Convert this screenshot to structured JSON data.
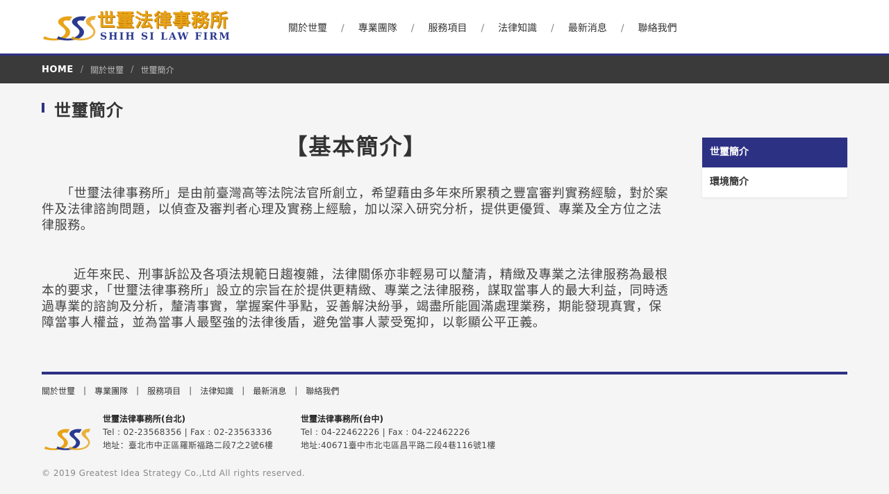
{
  "header": {
    "logo_name_zh": "世璽法律事務所",
    "logo_name_en": "SHIH SI LAW FIRM",
    "nav": [
      {
        "label": "關於世璽"
      },
      {
        "label": "專業團隊"
      },
      {
        "label": "服務項目"
      },
      {
        "label": "法律知識"
      },
      {
        "label": "最新消息"
      },
      {
        "label": "聯絡我們"
      }
    ],
    "nav_separator": "/"
  },
  "breadcrumb": {
    "home": "HOME",
    "separator": "/",
    "items": [
      "關於世璽",
      "世璽簡介"
    ]
  },
  "page": {
    "title": "世璽簡介",
    "section_title": "【基本簡介】",
    "paragraphs": [
      "「世璽法律事務所」是由前臺灣高等法院法官所創立，希望藉由多年來所累積之豐富審判實務經驗，對於案件及法律諮詢問題，以偵查及審判者心理及實務上經驗，加以深入研究分析，提供更優質、專業及全方位之法律服務。",
      "近年來民、刑事訴訟及各項法規範日趨複雜，法律關係亦非輕易可以釐清，精緻及專業之法律服務為最根本的要求，「世璽法律事務所」設立的宗旨在於提供更精緻、專業之法律服務，謀取當事人的最大利益，同時透過專業的諮詢及分析，釐清事實，掌握案件爭點，妥善解決紛爭，竭盡所能圓滿處理業務，期能發現真實，保障當事人權益，並為當事人最堅強的法律後盾，避免當事人蒙受冤抑，以彰顯公平正義。"
    ]
  },
  "sidebar": {
    "items": [
      {
        "label": "世璽簡介",
        "active": true
      },
      {
        "label": "環境簡介",
        "active": false
      }
    ]
  },
  "footer": {
    "nav": [
      {
        "label": "關於世璽"
      },
      {
        "label": "專業團隊"
      },
      {
        "label": "服務項目"
      },
      {
        "label": "法律知識"
      },
      {
        "label": "最新消息"
      },
      {
        "label": "聯絡我們"
      }
    ],
    "nav_separator": "|",
    "offices": [
      {
        "name": "世璽法律事務所(台北)",
        "phone": "Tel : 02-23568356 | Fax : 02-23563336",
        "address": "地址：臺北市中正區羅斯福路二段7之2號6樓"
      },
      {
        "name": "世璽法律事務所(台中)",
        "phone": "Tel : 04-22462226 | Fax : 04-22462226",
        "address": "地址:40671臺中市北屯區昌平路二段4巷116號1樓"
      }
    ],
    "copyright": "© 2019 Greatest Idea Strategy Co.,Ltd All rights reserved."
  },
  "colors": {
    "brand_navy": "#2d3184",
    "brand_gold": "#e8a317",
    "breadcrumb_bg": "#3a3a3a",
    "page_bg": "#f5f5f5"
  },
  "icons": {
    "logo": "sss-swoosh-logo-icon"
  }
}
